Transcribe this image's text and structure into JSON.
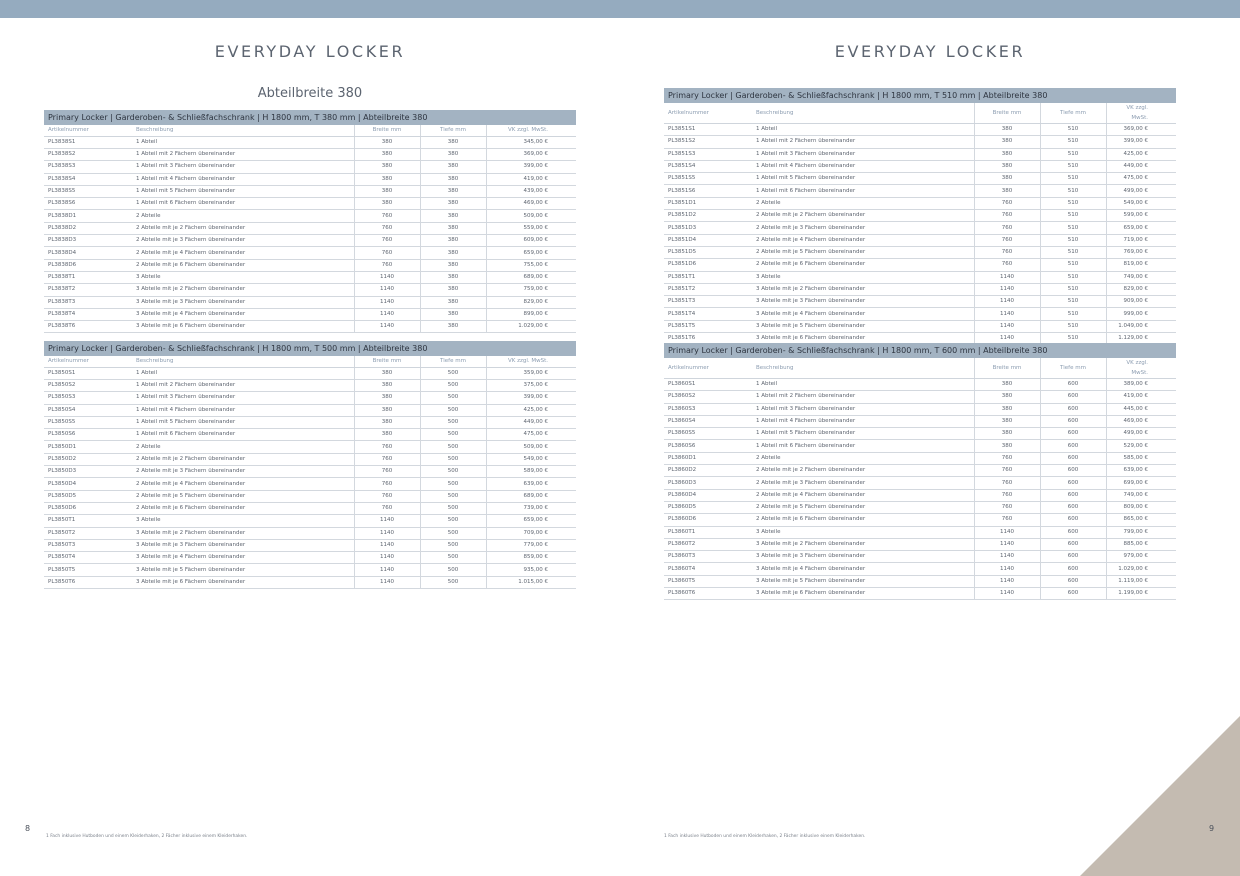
{
  "left_page": {
    "title": "EVERYDAY LOCKER",
    "subtitle": "Abteilbreite 380",
    "page_number": "8",
    "footnote": "1 Fach inklusive Hutboden und einem Kleiderhaken, 2 Fächer inklusive einem Kleiderhaken.",
    "tables": [
      {
        "caption": "Primary Locker | Garderoben- & Schließfachschrank | H 1800 mm, T 380 mm | Abteilbreite 380",
        "headers": [
          "Artikelnummer",
          "Beschreibung",
          "Breite mm",
          "Tiefe mm",
          "VK zzgl. MwSt."
        ],
        "rows": [
          [
            "PL3838S1",
            "1 Abteil",
            "380",
            "380",
            "345,00 €"
          ],
          [
            "PL3838S2",
            "1 Abteil mit 2 Fächern übereinander",
            "380",
            "380",
            "369,00 €"
          ],
          [
            "PL3838S3",
            "1 Abteil mit 3 Fächern übereinander",
            "380",
            "380",
            "399,00 €"
          ],
          [
            "PL3838S4",
            "1 Abteil mit 4 Fächern übereinander",
            "380",
            "380",
            "419,00 €"
          ],
          [
            "PL3838S5",
            "1 Abteil mit 5 Fächern übereinander",
            "380",
            "380",
            "439,00 €"
          ],
          [
            "PL3838S6",
            "1 Abteil mit 6 Fächern übereinander",
            "380",
            "380",
            "469,00 €"
          ],
          [
            "PL3838D1",
            "2 Abteile",
            "760",
            "380",
            "509,00 €"
          ],
          [
            "PL3838D2",
            "2 Abteile mit je 2 Fächern übereinander",
            "760",
            "380",
            "559,00 €"
          ],
          [
            "PL3838D3",
            "2 Abteile mit je 3 Fächern übereinander",
            "760",
            "380",
            "609,00 €"
          ],
          [
            "PL3838D4",
            "2 Abteile mit je 4 Fächern übereinander",
            "760",
            "380",
            "659,00 €"
          ],
          [
            "PL3838D6",
            "2 Abteile mit je 6 Fächern übereinander",
            "760",
            "380",
            "755,00 €"
          ],
          [
            "PL3838T1",
            "3 Abteile",
            "1140",
            "380",
            "689,00 €"
          ],
          [
            "PL3838T2",
            "3 Abteile mit je 2 Fächern übereinander",
            "1140",
            "380",
            "759,00 €"
          ],
          [
            "PL3838T3",
            "3 Abteile mit je 3 Fächern übereinander",
            "1140",
            "380",
            "829,00 €"
          ],
          [
            "PL3838T4",
            "3 Abteile mit je 4 Fächern übereinander",
            "1140",
            "380",
            "899,00 €"
          ],
          [
            "PL3838T6",
            "3 Abteile mit je 6 Fächern übereinander",
            "1140",
            "380",
            "1.029,00 €"
          ]
        ]
      },
      {
        "caption": "Primary Locker | Garderoben- & Schließfachschrank | H 1800 mm, T 500 mm | Abteilbreite 380",
        "headers": [
          "Artikelnummer",
          "Beschreibung",
          "Breite mm",
          "Tiefe mm",
          "VK zzgl. MwSt."
        ],
        "rows": [
          [
            "PL3850S1",
            "1 Abteil",
            "380",
            "500",
            "359,00 €"
          ],
          [
            "PL3850S2",
            "1 Abteil mit 2 Fächern übereinander",
            "380",
            "500",
            "375,00 €"
          ],
          [
            "PL3850S3",
            "1 Abteil mit 3 Fächern übereinander",
            "380",
            "500",
            "399,00 €"
          ],
          [
            "PL3850S4",
            "1 Abteil mit 4 Fächern übereinander",
            "380",
            "500",
            "425,00 €"
          ],
          [
            "PL3850S5",
            "1 Abteil mit 5 Fächern übereinander",
            "380",
            "500",
            "449,00 €"
          ],
          [
            "PL3850S6",
            "1 Abteil mit 6 Fächern übereinander",
            "380",
            "500",
            "475,00 €"
          ],
          [
            "PL3850D1",
            "2 Abteile",
            "760",
            "500",
            "509,00 €"
          ],
          [
            "PL3850D2",
            "2 Abteile mit je 2 Fächern übereinander",
            "760",
            "500",
            "549,00 €"
          ],
          [
            "PL3850D3",
            "2 Abteile mit je 3 Fächern übereinander",
            "760",
            "500",
            "589,00 €"
          ],
          [
            "PL3850D4",
            "2 Abteile mit je 4 Fächern übereinander",
            "760",
            "500",
            "639,00 €"
          ],
          [
            "PL3850D5",
            "2 Abteile mit je 5 Fächern übereinander",
            "760",
            "500",
            "689,00 €"
          ],
          [
            "PL3850D6",
            "2 Abteile mit je 6 Fächern übereinander",
            "760",
            "500",
            "739,00 €"
          ],
          [
            "PL3850T1",
            "3 Abteile",
            "1140",
            "500",
            "659,00 €"
          ],
          [
            "PL3850T2",
            "3 Abteile mit je 2 Fächern übereinander",
            "1140",
            "500",
            "709,00 €"
          ],
          [
            "PL3850T3",
            "3 Abteile mit je 3 Fächern übereinander",
            "1140",
            "500",
            "779,00 €"
          ],
          [
            "PL3850T4",
            "3 Abteile mit je 4 Fächern übereinander",
            "1140",
            "500",
            "859,00 €"
          ],
          [
            "PL3850T5",
            "3 Abteile mit je 5 Fächern übereinander",
            "1140",
            "500",
            "935,00 €"
          ],
          [
            "PL3850T6",
            "3 Abteile mit je 6 Fächern übereinander",
            "1140",
            "500",
            "1.015,00 €"
          ]
        ]
      }
    ]
  },
  "right_page": {
    "title": "EVERYDAY LOCKER",
    "page_number": "9",
    "footnote": "1 Fach inklusive Hutboden und einem Kleiderhaken, 2 Fächer inklusive einem Kleiderhaken.",
    "tables": [
      {
        "caption": "Primary Locker | Garderoben- & Schließfachschrank | H 1800 mm, T 510 mm | Abteilbreite 380",
        "headers": [
          "Artikelnummer",
          "Beschreibung",
          "Breite mm",
          "Tiefe mm",
          "VK zzgl. MwSt."
        ],
        "rows": [
          [
            "PL3851S1",
            "1 Abteil",
            "380",
            "510",
            "369,00 €"
          ],
          [
            "PL3851S2",
            "1 Abteil mit 2 Fächern übereinander",
            "380",
            "510",
            "399,00 €"
          ],
          [
            "PL3851S3",
            "1 Abteil mit 3 Fächern übereinander",
            "380",
            "510",
            "425,00 €"
          ],
          [
            "PL3851S4",
            "1 Abteil mit 4 Fächern übereinander",
            "380",
            "510",
            "449,00 €"
          ],
          [
            "PL3851S5",
            "1 Abteil mit 5 Fächern übereinander",
            "380",
            "510",
            "475,00 €"
          ],
          [
            "PL3851S6",
            "1 Abteil mit 6 Fächern übereinander",
            "380",
            "510",
            "499,00 €"
          ],
          [
            "PL3851D1",
            "2 Abteile",
            "760",
            "510",
            "549,00 €"
          ],
          [
            "PL3851D2",
            "2 Abteile mit je 2 Fächern übereinander",
            "760",
            "510",
            "599,00 €"
          ],
          [
            "PL3851D3",
            "2 Abteile mit je 3 Fächern übereinander",
            "760",
            "510",
            "659,00 €"
          ],
          [
            "PL3851D4",
            "2 Abteile mit je 4 Fächern übereinander",
            "760",
            "510",
            "719,00 €"
          ],
          [
            "PL3851D5",
            "2 Abteile mit je 5 Fächern übereinander",
            "760",
            "510",
            "769,00 €"
          ],
          [
            "PL3851D6",
            "2 Abteile mit je 6 Fächern übereinander",
            "760",
            "510",
            "819,00 €"
          ],
          [
            "PL3851T1",
            "3 Abteile",
            "1140",
            "510",
            "749,00 €"
          ],
          [
            "PL3851T2",
            "3 Abteile mit je 2 Fächern übereinander",
            "1140",
            "510",
            "829,00 €"
          ],
          [
            "PL3851T3",
            "3 Abteile mit je 3 Fächern übereinander",
            "1140",
            "510",
            "909,00 €"
          ],
          [
            "PL3851T4",
            "3 Abteile mit je 4 Fächern übereinander",
            "1140",
            "510",
            "999,00 €"
          ],
          [
            "PL3851T5",
            "3 Abteile mit je 5 Fächern übereinander",
            "1140",
            "510",
            "1.049,00 €"
          ],
          [
            "PL3851T6",
            "3 Abteile mit je 6 Fächern übereinander",
            "1140",
            "510",
            "1.129,00 €"
          ]
        ]
      },
      {
        "caption": "Primary Locker | Garderoben- & Schließfachschrank | H 1800 mm, T 600 mm | Abteilbreite 380",
        "headers": [
          "Artikelnummer",
          "Beschreibung",
          "Breite mm",
          "Tiefe mm",
          "VK zzgl. MwSt."
        ],
        "rows": [
          [
            "PL3860S1",
            "1 Abteil",
            "380",
            "600",
            "389,00 €"
          ],
          [
            "PL3860S2",
            "1 Abteil mit 2 Fächern übereinander",
            "380",
            "600",
            "419,00 €"
          ],
          [
            "PL3860S3",
            "1 Abteil mit 3 Fächern übereinander",
            "380",
            "600",
            "445,00 €"
          ],
          [
            "PL3860S4",
            "1 Abteil mit 4 Fächern übereinander",
            "380",
            "600",
            "469,00 €"
          ],
          [
            "PL3860S5",
            "1 Abteil mit 5 Fächern übereinander",
            "380",
            "600",
            "499,00 €"
          ],
          [
            "PL3860S6",
            "1 Abteil mit 6 Fächern übereinander",
            "380",
            "600",
            "529,00 €"
          ],
          [
            "PL3860D1",
            "2 Abteile",
            "760",
            "600",
            "585,00 €"
          ],
          [
            "PL3860D2",
            "2 Abteile mit je 2 Fächern übereinander",
            "760",
            "600",
            "639,00 €"
          ],
          [
            "PL3860D3",
            "2 Abteile mit je 3 Fächern übereinander",
            "760",
            "600",
            "699,00 €"
          ],
          [
            "PL3860D4",
            "2 Abteile mit je 4 Fächern übereinander",
            "760",
            "600",
            "749,00 €"
          ],
          [
            "PL3860D5",
            "2 Abteile mit je 5 Fächern übereinander",
            "760",
            "600",
            "809,00 €"
          ],
          [
            "PL3860D6",
            "2 Abteile mit je 6 Fächern übereinander",
            "760",
            "600",
            "865,00 €"
          ],
          [
            "PL3860T1",
            "3 Abteile",
            "1140",
            "600",
            "799,00 €"
          ],
          [
            "PL3860T2",
            "3 Abteile mit je 2 Fächern übereinander",
            "1140",
            "600",
            "885,00 €"
          ],
          [
            "PL3860T3",
            "3 Abteile mit je 3 Fächern übereinander",
            "1140",
            "600",
            "979,00 €"
          ],
          [
            "PL3860T4",
            "3 Abteile mit je 4 Fächern übereinander",
            "1140",
            "600",
            "1.029,00 €"
          ],
          [
            "PL3860T5",
            "3 Abteile mit je 5 Fächern übereinander",
            "1140",
            "600",
            "1.119,00 €"
          ],
          [
            "PL3860T6",
            "3 Abteile mit je 6 Fächern übereinander",
            "1140",
            "600",
            "1.199,00 €"
          ]
        ]
      }
    ]
  },
  "colors": {
    "top_bar": "#95abbf",
    "table_caption_bg": "#a3b3c2",
    "header_text": "#8b9cb0",
    "corner_triangle": "#c4bbb1"
  }
}
